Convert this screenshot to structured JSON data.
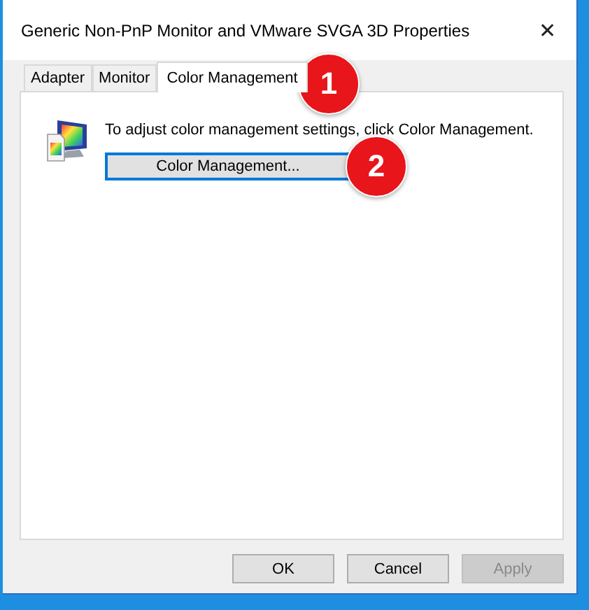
{
  "window": {
    "title": "Generic Non-PnP Monitor and VMware SVGA 3D Properties",
    "close": "✕"
  },
  "tabs": [
    {
      "label": "Adapter",
      "selected": false
    },
    {
      "label": "Monitor",
      "selected": false
    },
    {
      "label": "Color Management",
      "selected": true
    }
  ],
  "panel": {
    "text": "To adjust color management settings, click Color Management.",
    "button": {
      "label": "Color Management...",
      "focused": true
    }
  },
  "callouts": [
    {
      "label": "1"
    },
    {
      "label": "2"
    }
  ],
  "buttons": [
    {
      "label": "OK",
      "disabled": false
    },
    {
      "label": "Cancel",
      "disabled": false
    },
    {
      "label": "Apply",
      "disabled": true
    }
  ]
}
